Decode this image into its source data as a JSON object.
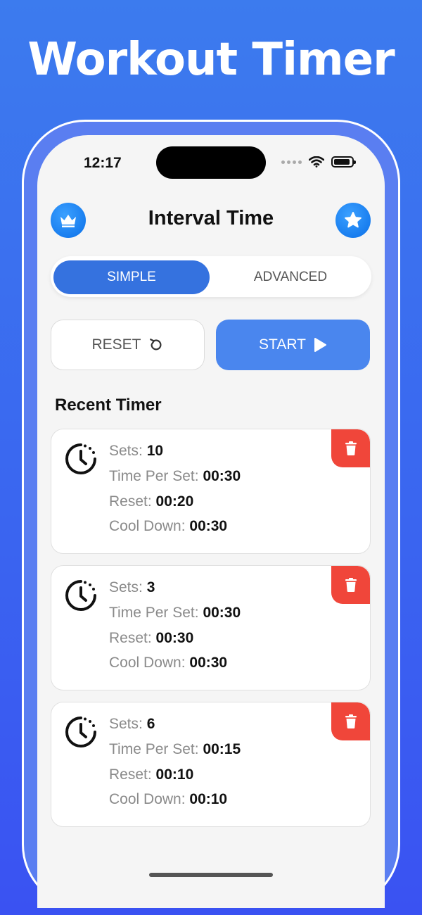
{
  "headline": "Workout Timer",
  "status_bar": {
    "time": "12:17"
  },
  "header": {
    "title": "Interval Time",
    "left_icon": "crown-icon",
    "right_icon": "star-icon"
  },
  "tabs": [
    {
      "label": "SIMPLE",
      "selected": true
    },
    {
      "label": "ADVANCED",
      "selected": false
    }
  ],
  "actions": {
    "reset_label": "RESET",
    "start_label": "START"
  },
  "recent": {
    "title": "Recent Timer",
    "field_labels": {
      "sets": "Sets:",
      "time_per_set": "Time Per Set:",
      "reset": "Reset:",
      "cool_down": "Cool Down:"
    },
    "items": [
      {
        "sets": "10",
        "time_per_set": "00:30",
        "reset": "00:20",
        "cool_down": "00:30"
      },
      {
        "sets": "3",
        "time_per_set": "00:30",
        "reset": "00:30",
        "cool_down": "00:30"
      },
      {
        "sets": "6",
        "time_per_set": "00:15",
        "reset": "00:10",
        "cool_down": "00:10"
      }
    ]
  },
  "colors": {
    "primary": "#3572df",
    "start": "#4a86ee",
    "delete": "#f0463a",
    "background": "#3c6cf0"
  }
}
